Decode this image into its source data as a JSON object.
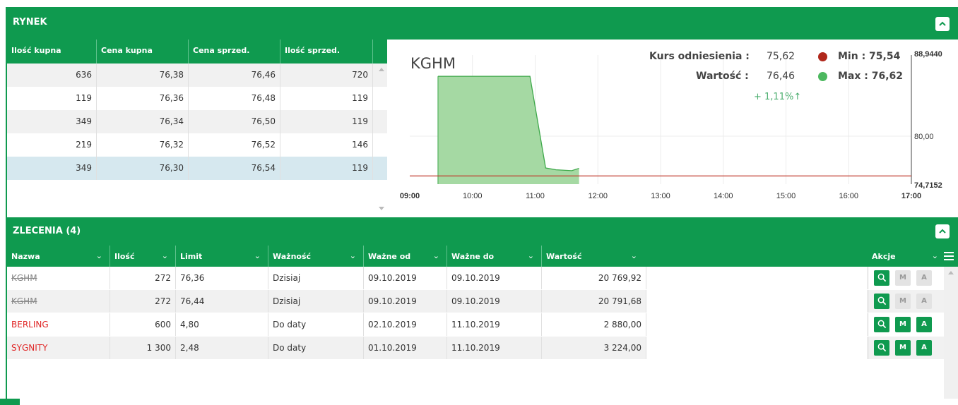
{
  "rynek": {
    "title": "RYNEK"
  },
  "book": {
    "headers": [
      "Ilość kupna",
      "Cena kupna",
      "Cena sprzed.",
      "Ilość sprzed."
    ],
    "rows": [
      [
        "636",
        "76,38",
        "76,46",
        "720"
      ],
      [
        "119",
        "76,36",
        "76,48",
        "119"
      ],
      [
        "349",
        "76,34",
        "76,50",
        "119"
      ],
      [
        "219",
        "76,32",
        "76,52",
        "146"
      ],
      [
        "349",
        "76,30",
        "76,54",
        "119"
      ]
    ]
  },
  "quote": {
    "symbol": "KGHM",
    "ref_label": "Kurs odniesienia :",
    "ref_value": "75,62",
    "value_label": "Wartość :",
    "value": "76,46",
    "change": "+ 1,11%",
    "change_arrow": "↑",
    "min_label": "Min : 75,54",
    "max_label": "Max : 76,62",
    "min_color": "#b0271b",
    "max_color": "#4cb85f"
  },
  "chart_data": {
    "type": "area",
    "x_ticks": [
      "09:00",
      "10:00",
      "11:00",
      "12:00",
      "13:00",
      "14:00",
      "15:00",
      "16:00",
      "17:00"
    ],
    "y_ticks": [
      "88,9440",
      "80,00",
      "74,7152"
    ],
    "ylim": [
      74.7152,
      88.944
    ],
    "reference_line": 75.62,
    "series": [
      {
        "x": [
          "09:27",
          "10:55",
          "11:10",
          "11:20",
          "11:35",
          "11:42"
        ],
        "values": [
          86.6,
          86.6,
          76.5,
          76.3,
          76.2,
          76.46
        ]
      }
    ]
  },
  "zlecenia": {
    "title": "ZLECENIA (4)"
  },
  "orders": {
    "headers": [
      "Nazwa",
      "Ilość",
      "Limit",
      "Ważność",
      "Ważne od",
      "Ważne do",
      "Wartość"
    ],
    "actions_header": "Akcje",
    "rows": [
      {
        "name": "KGHM",
        "qty": "272",
        "limit": "76,36",
        "validity": "Dzisiaj",
        "from": "09.10.2019",
        "to": "09.10.2019",
        "value": "20 769,92",
        "style": "strike",
        "mod": false
      },
      {
        "name": "KGHM",
        "qty": "272",
        "limit": "76,44",
        "validity": "Dzisiaj",
        "from": "09.10.2019",
        "to": "09.10.2019",
        "value": "20 791,68",
        "style": "strike",
        "mod": false
      },
      {
        "name": "BERLING",
        "qty": "600",
        "limit": "4,80",
        "validity": "Do daty",
        "from": "02.10.2019",
        "to": "11.10.2019",
        "value": "2 880,00",
        "style": "red",
        "mod": true
      },
      {
        "name": "SYGNITY",
        "qty": "1 300",
        "limit": "2,48",
        "validity": "Do daty",
        "from": "01.10.2019",
        "to": "11.10.2019",
        "value": "3 224,00",
        "style": "red",
        "mod": true
      }
    ],
    "btn_m": "M",
    "btn_a": "A"
  },
  "colors": {
    "accent": "#0f9a4f"
  }
}
